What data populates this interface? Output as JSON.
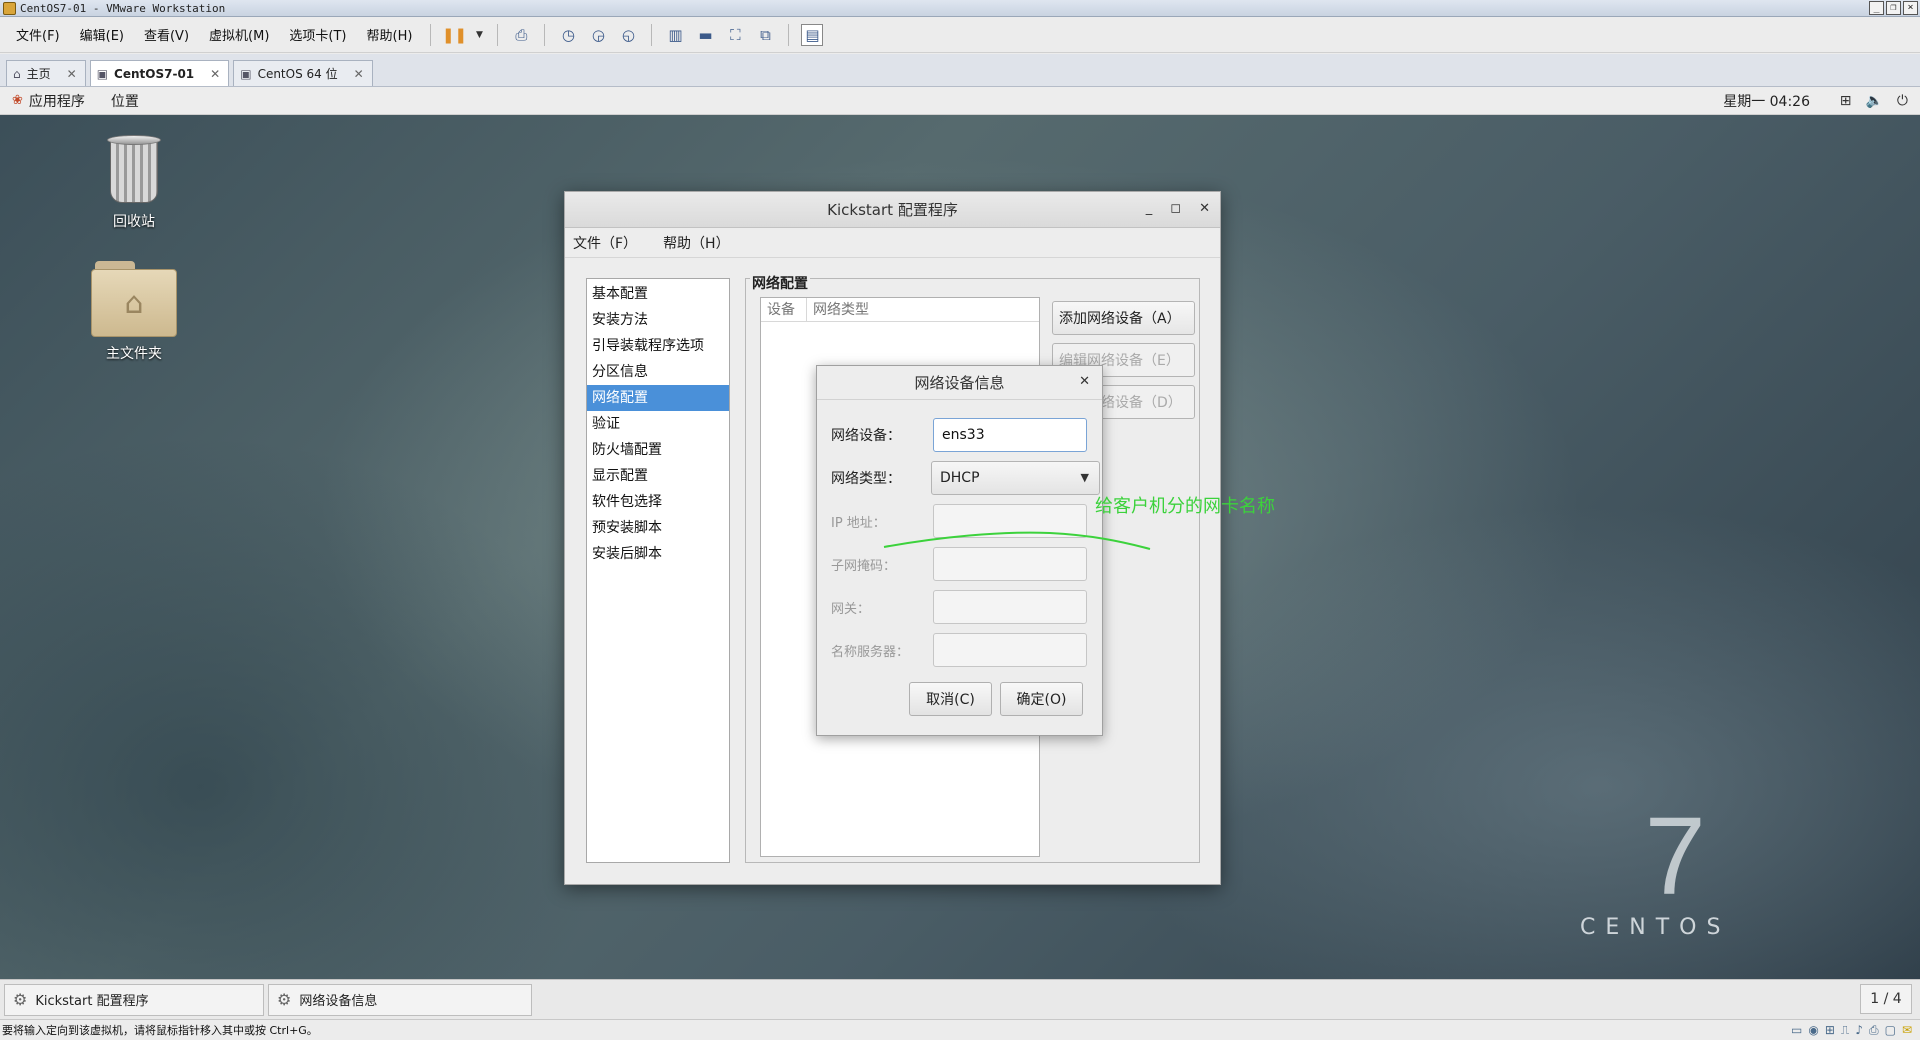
{
  "vmware": {
    "title": "CentOS7-01 - VMware Workstation",
    "menu": [
      "文件(F)",
      "编辑(E)",
      "查看(V)",
      "虚拟机(M)",
      "选项卡(T)",
      "帮助(H)"
    ],
    "tabs": [
      {
        "label": "主页",
        "icon": "home-icon"
      },
      {
        "label": "CentOS7-01",
        "icon": "vm-icon"
      },
      {
        "label": "CentOS 64 位",
        "icon": "vm-icon"
      }
    ],
    "status_hint": "要将输入定向到该虚拟机，请将鼠标指针移入其中或按 Ctrl+G。"
  },
  "gnome": {
    "apps_label": "应用程序",
    "places_label": "位置",
    "clock": "星期一 04:26"
  },
  "desktop": {
    "trash_label": "回收站",
    "home_label": "主文件夹",
    "brand_number": "7",
    "brand_word": "CENTOS"
  },
  "kickstart": {
    "title": "Kickstart 配置程序",
    "menu": [
      "文件（F）",
      "帮助（H）"
    ],
    "sidebar": [
      "基本配置",
      "安装方法",
      "引导装载程序选项",
      "分区信息",
      "网络配置",
      "验证",
      "防火墙配置",
      "显示配置",
      "软件包选择",
      "预安装脚本",
      "安装后脚本"
    ],
    "selected_index": 4,
    "panel_title": "网络配置",
    "table_headers": [
      "设备",
      "网络类型"
    ],
    "buttons": {
      "add": "添加网络设备（A）",
      "edit": "编辑网络设备（E）",
      "delete": "删除网络设备（D）"
    }
  },
  "net_dialog": {
    "title": "网络设备信息",
    "device_label": "网络设备：",
    "device_value": "ens33",
    "type_label": "网络类型：",
    "type_value": "DHCP",
    "ip_label": "IP 地址：",
    "netmask_label": "子网掩码：",
    "gateway_label": "网关：",
    "dns_label": "名称服务器：",
    "cancel": "取消(C)",
    "ok": "确定(O)"
  },
  "annotation": {
    "text": "给客户机分的网卡名称",
    "color": "#3cd23c"
  },
  "taskbar": {
    "items": [
      "Kickstart 配置程序",
      "网络设备信息"
    ],
    "pager": "1 / 4"
  }
}
